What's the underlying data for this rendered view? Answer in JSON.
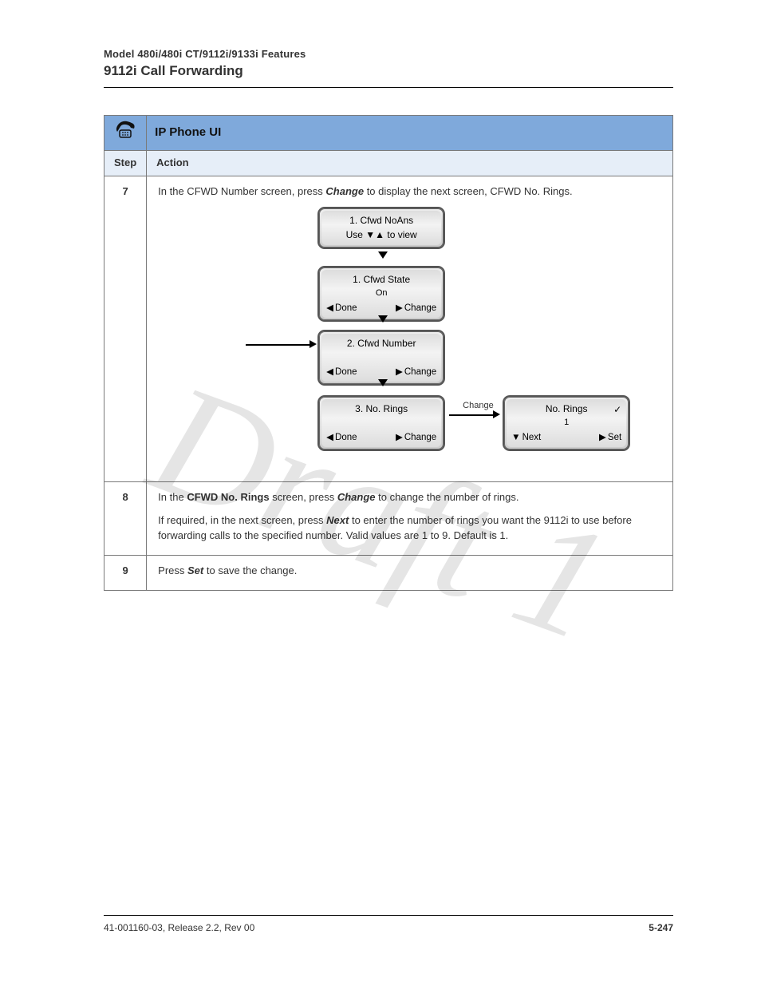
{
  "header": {
    "eyebrow": "Model 480i/480i CT/9112i/9133i Features",
    "title": "9112i Call Forwarding"
  },
  "banner": {
    "title": "IP Phone UI"
  },
  "subhead": {
    "step": "Step",
    "action": "Action"
  },
  "row7": {
    "num": "7",
    "text_a": "In the CFWD Number screen, press ",
    "text_b": " to display the next screen, CFWD No. Rings.",
    "btn": "Change"
  },
  "flow": {
    "s1_l1": "1. Cfwd NoAns",
    "s1_l2": "Use ▼▲ to view",
    "s2_l1": "1. Cfwd State",
    "s2_l2": "On",
    "s3_l1": "2. Cfwd Number",
    "s4_l1": "3. No. Rings",
    "s5_l1": "No. Rings",
    "s5_l2": "1",
    "done": "Done",
    "change": "Change",
    "next": "Next",
    "set": "Set",
    "change_label": "Change",
    "tick": "✓"
  },
  "row8": {
    "num": "8",
    "p1a": "In the ",
    "p1b": "CFWD No. Rings",
    "p1c": " screen, press ",
    "p1d": " to change the number of rings.",
    "btn": "Change",
    "p2a": "If required, in the next screen, press ",
    "p2b": " to enter the number of rings you want the 9112i to use before forwarding calls to the specified number. Valid values are 1 to 9. Default is 1.",
    "btn2": "Next"
  },
  "row9": {
    "num": "9",
    "ta": "Press ",
    "tb": " to save the change.",
    "btn": "Set"
  },
  "footer": {
    "docid": "41-001160-03, Release 2.2, Rev 00",
    "page": "5-247"
  },
  "watermark": "Draft 1"
}
